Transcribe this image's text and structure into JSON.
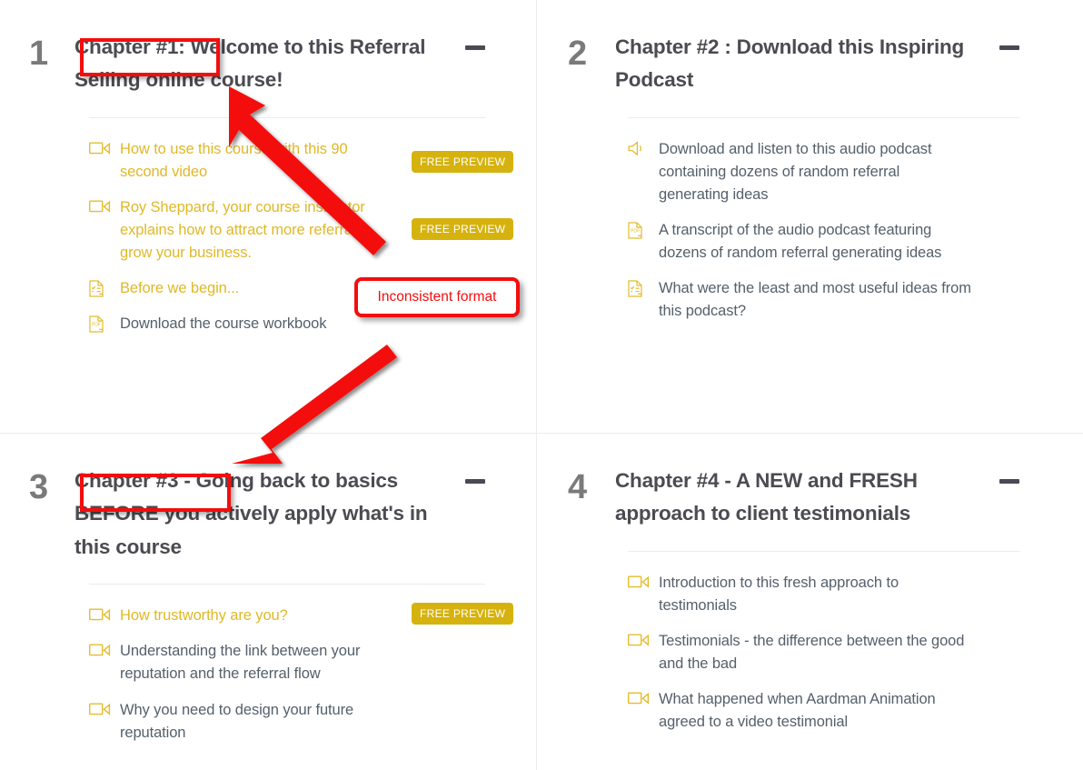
{
  "icons": {
    "video": "video-camera-icon",
    "pdf": "pdf-document-icon",
    "quiz": "quiz-form-icon",
    "audio": "audio-speaker-icon",
    "collapse": "minus-collapse-icon"
  },
  "colors": {
    "accent_gold": "#e0b827",
    "badge_gold": "#d6b20f",
    "text_slate": "#55606b",
    "title_slate": "#4b4b52",
    "number_gray": "#7a7a7a",
    "divider": "#ececec",
    "annotation_red": "#f40d0d"
  },
  "badge_label": "FREE PREVIEW",
  "chapters": [
    {
      "number": "1",
      "title": "Chapter #1: Welcome to this Referral Selling online course!",
      "collapse_label": "–",
      "lessons": [
        {
          "icon": "video",
          "label": "How to use this course with this 90 second video",
          "preview": true,
          "free": true
        },
        {
          "icon": "video",
          "label": "Roy Sheppard, your course instructor explains how to attract more referrals grow your business.",
          "preview": true,
          "free": true
        },
        {
          "icon": "quiz",
          "label": "Before we begin...",
          "preview": true,
          "free": false
        },
        {
          "icon": "pdf",
          "label": "Download the course workbook",
          "preview": false,
          "free": false
        }
      ]
    },
    {
      "number": "2",
      "title": "Chapter #2 : Download this Inspiring Podcast",
      "collapse_label": "–",
      "lessons": [
        {
          "icon": "audio",
          "label": "Download and listen to this audio podcast containing dozens of random referral generating ideas",
          "preview": false,
          "free": false
        },
        {
          "icon": "pdf",
          "label": "A transcript of the audio podcast featuring dozens of random referral generating ideas",
          "preview": false,
          "free": false
        },
        {
          "icon": "quiz",
          "label": "What were the least and most useful ideas from this podcast?",
          "preview": false,
          "free": false
        }
      ]
    },
    {
      "number": "3",
      "title": "Chapter #3 - Going back to basics BEFORE you actively apply what's in this course",
      "collapse_label": "–",
      "lessons": [
        {
          "icon": "video",
          "label": "How trustworthy are you?",
          "preview": true,
          "free": true
        },
        {
          "icon": "video",
          "label": "Understanding the link between your reputation and the referral flow",
          "preview": false,
          "free": false
        },
        {
          "icon": "video",
          "label": "Why you need to design your future reputation",
          "preview": false,
          "free": false
        }
      ]
    },
    {
      "number": "4",
      "title": "Chapter #4 - A NEW and FRESH approach to client testimonials",
      "collapse_label": "–",
      "lessons": [
        {
          "icon": "video",
          "label": "Introduction to this fresh approach to testimonials",
          "preview": false,
          "free": false
        },
        {
          "icon": "video",
          "label": "Testimonials - the difference between the good and the bad",
          "preview": false,
          "free": false
        },
        {
          "icon": "video",
          "label": "What happened when Aardman Animation agreed to a video testimonial",
          "preview": false,
          "free": false
        }
      ]
    }
  ],
  "annotations": {
    "callout_text": "Inconsistent format",
    "highlight_1_target": "Chapter #1:",
    "highlight_2_target": "Chapter #3 -"
  }
}
